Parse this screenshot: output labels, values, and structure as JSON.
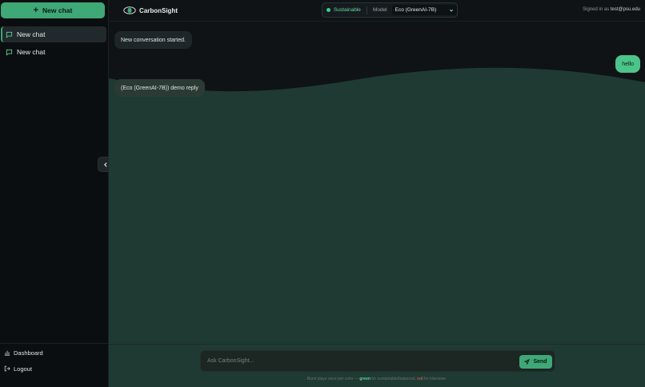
{
  "sidebar": {
    "new_chat_label": "New chat",
    "chats": [
      {
        "label": "New chat",
        "active": true
      },
      {
        "label": "New chat",
        "active": false
      }
    ],
    "links": {
      "dashboard": "Dashboard",
      "logout": "Logout"
    }
  },
  "header": {
    "brand": "CarbonSight",
    "status": "Sustainable",
    "model_label": "Model",
    "model_value": "Eco (GreenAI-7B)",
    "signed_in_prefix": "Signed in as",
    "user_email": "test@psu.edu"
  },
  "messages": {
    "system": "New conversation started.",
    "user": "hello",
    "assistant": "(Eco (GreenAI-7B)) demo reply"
  },
  "composer": {
    "placeholder": "Ask CarbonSight...",
    "send_label": "Send"
  },
  "hint": {
    "prefix": "Burst plays once per color —",
    "green": "green",
    "middle": "for sustainable/balanced,",
    "red": "red",
    "suffix": "for intensive."
  },
  "colors": {
    "accent": "#3fa877",
    "user_bubble": "#4cc58b",
    "wave_fill": "#1f3a32",
    "intensive": "#e06a5f"
  }
}
